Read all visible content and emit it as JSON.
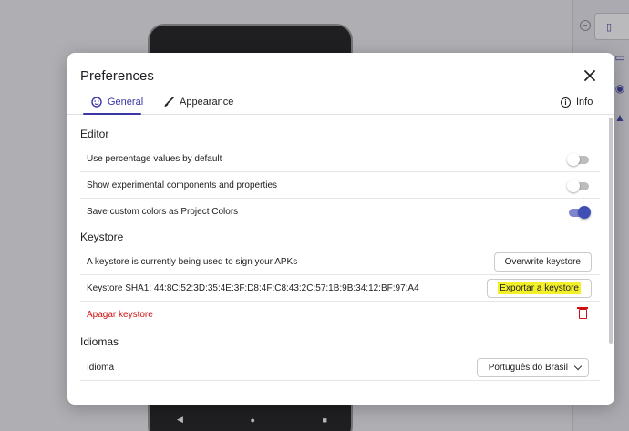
{
  "dialog": {
    "title": "Preferences",
    "tabs": [
      {
        "label": "General",
        "icon": "emoji-icon"
      },
      {
        "label": "Appearance",
        "icon": "brush-icon"
      },
      {
        "label": "Info",
        "icon": "info-icon"
      }
    ],
    "sections": {
      "editor": {
        "title": "Editor",
        "rows": [
          {
            "label": "Use percentage values by default",
            "on": false
          },
          {
            "label": "Show experimental components and properties",
            "on": false
          },
          {
            "label": "Save custom colors as Project Colors",
            "on": true
          }
        ]
      },
      "keystore": {
        "title": "Keystore",
        "status": "A keystore is currently being used to sign your APKs",
        "overwrite_label": "Overwrite keystore",
        "sha_text": "Keystore SHA1: 44:8C:52:3D:35:4E:3F:D8:4F:C8:43:2C:57:1B:9B:34:12:BF:97:A4",
        "export_label": "Exportar a keystore",
        "delete_label": "Apagar keystore"
      },
      "languages": {
        "title": "Idiomas",
        "language_label": "Idioma",
        "language_value": "Português do Brasil"
      }
    }
  },
  "colors": {
    "accent": "#3b36a6",
    "danger": "#d20f0f",
    "highlight": "#f3f02a"
  }
}
